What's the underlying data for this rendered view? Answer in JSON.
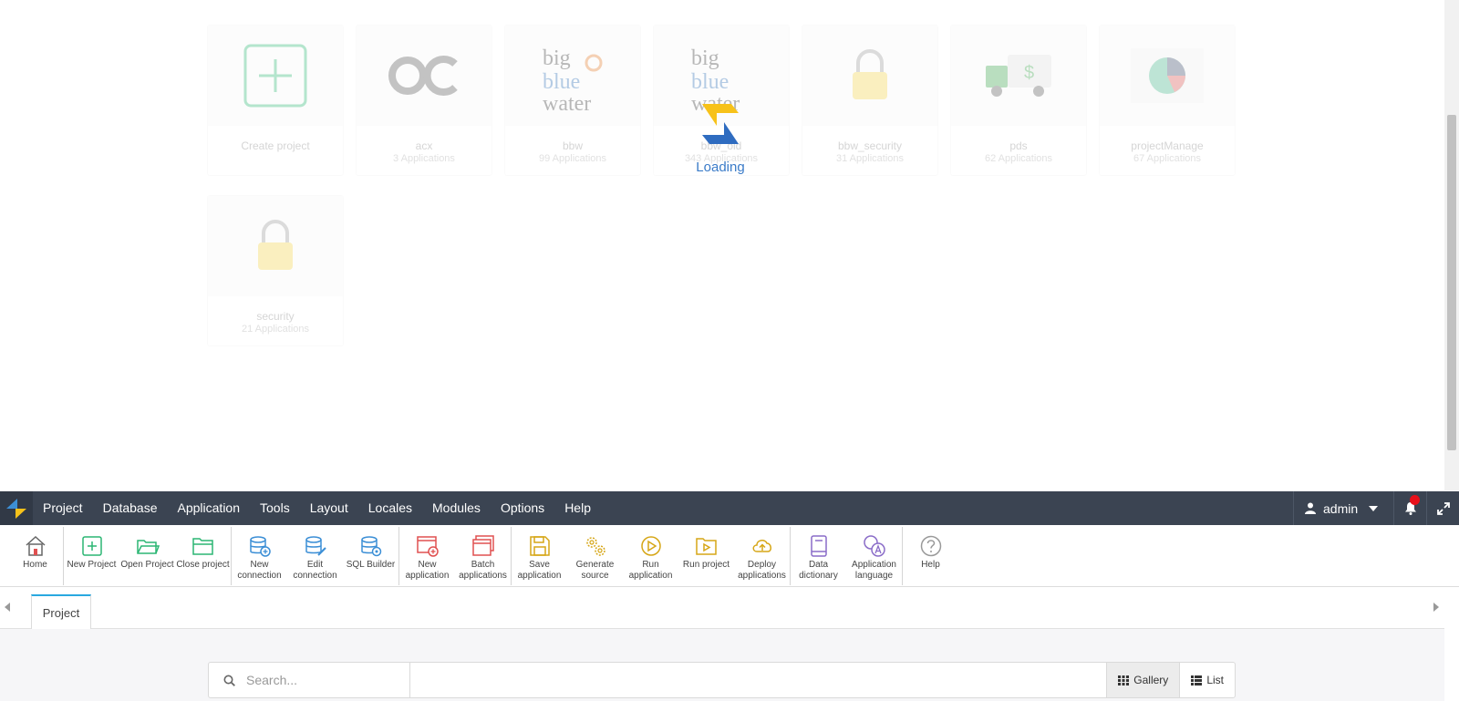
{
  "gallery": {
    "cards": [
      {
        "name": "Create project",
        "count": ""
      },
      {
        "name": "acx",
        "count": "3 Applications"
      },
      {
        "name": "bbw",
        "count": "99 Applications"
      },
      {
        "name": "bbw_old",
        "count": "343 Applications"
      },
      {
        "name": "bbw_security",
        "count": "31 Applications"
      },
      {
        "name": "pds",
        "count": "62 Applications"
      },
      {
        "name": "projectManage",
        "count": "67 Applications"
      },
      {
        "name": "security",
        "count": "21 Applications"
      }
    ],
    "loading_text": "Loading"
  },
  "menubar": {
    "items": [
      "Project",
      "Database",
      "Application",
      "Tools",
      "Layout",
      "Locales",
      "Modules",
      "Options",
      "Help"
    ],
    "user": "admin"
  },
  "toolbar": {
    "groups": [
      [
        {
          "label": "Home",
          "icon": "home-icon"
        }
      ],
      [
        {
          "label": "New Project",
          "icon": "new-project-icon"
        },
        {
          "label": "Open Project",
          "icon": "open-project-icon"
        },
        {
          "label": "Close project",
          "icon": "close-project-icon"
        }
      ],
      [
        {
          "label": "New connection",
          "icon": "new-connection-icon"
        },
        {
          "label": "Edit connection",
          "icon": "edit-connection-icon"
        },
        {
          "label": "SQL Builder",
          "icon": "sql-builder-icon"
        }
      ],
      [
        {
          "label": "New application",
          "icon": "new-application-icon"
        },
        {
          "label": "Batch applications",
          "icon": "batch-applications-icon"
        }
      ],
      [
        {
          "label": "Save application",
          "icon": "save-application-icon"
        },
        {
          "label": "Generate source",
          "icon": "generate-source-icon"
        },
        {
          "label": "Run application",
          "icon": "run-application-icon"
        },
        {
          "label": "Run project",
          "icon": "run-project-icon"
        },
        {
          "label": "Deploy applications",
          "icon": "deploy-applications-icon"
        }
      ],
      [
        {
          "label": "Data dictionary",
          "icon": "data-dictionary-icon"
        },
        {
          "label": "Application language",
          "icon": "application-language-icon"
        }
      ],
      [
        {
          "label": "Help",
          "icon": "help-icon"
        }
      ]
    ]
  },
  "tabs": {
    "active": "Project"
  },
  "search": {
    "placeholder": "Search...",
    "value": ""
  },
  "view": {
    "gallery_label": "Gallery",
    "list_label": "List",
    "selected": "Gallery"
  },
  "colors": {
    "menubar": "#3b4452",
    "tab_accent": "#29a8e0",
    "loading": "#3a7bc8",
    "notify": "#e8101a"
  }
}
